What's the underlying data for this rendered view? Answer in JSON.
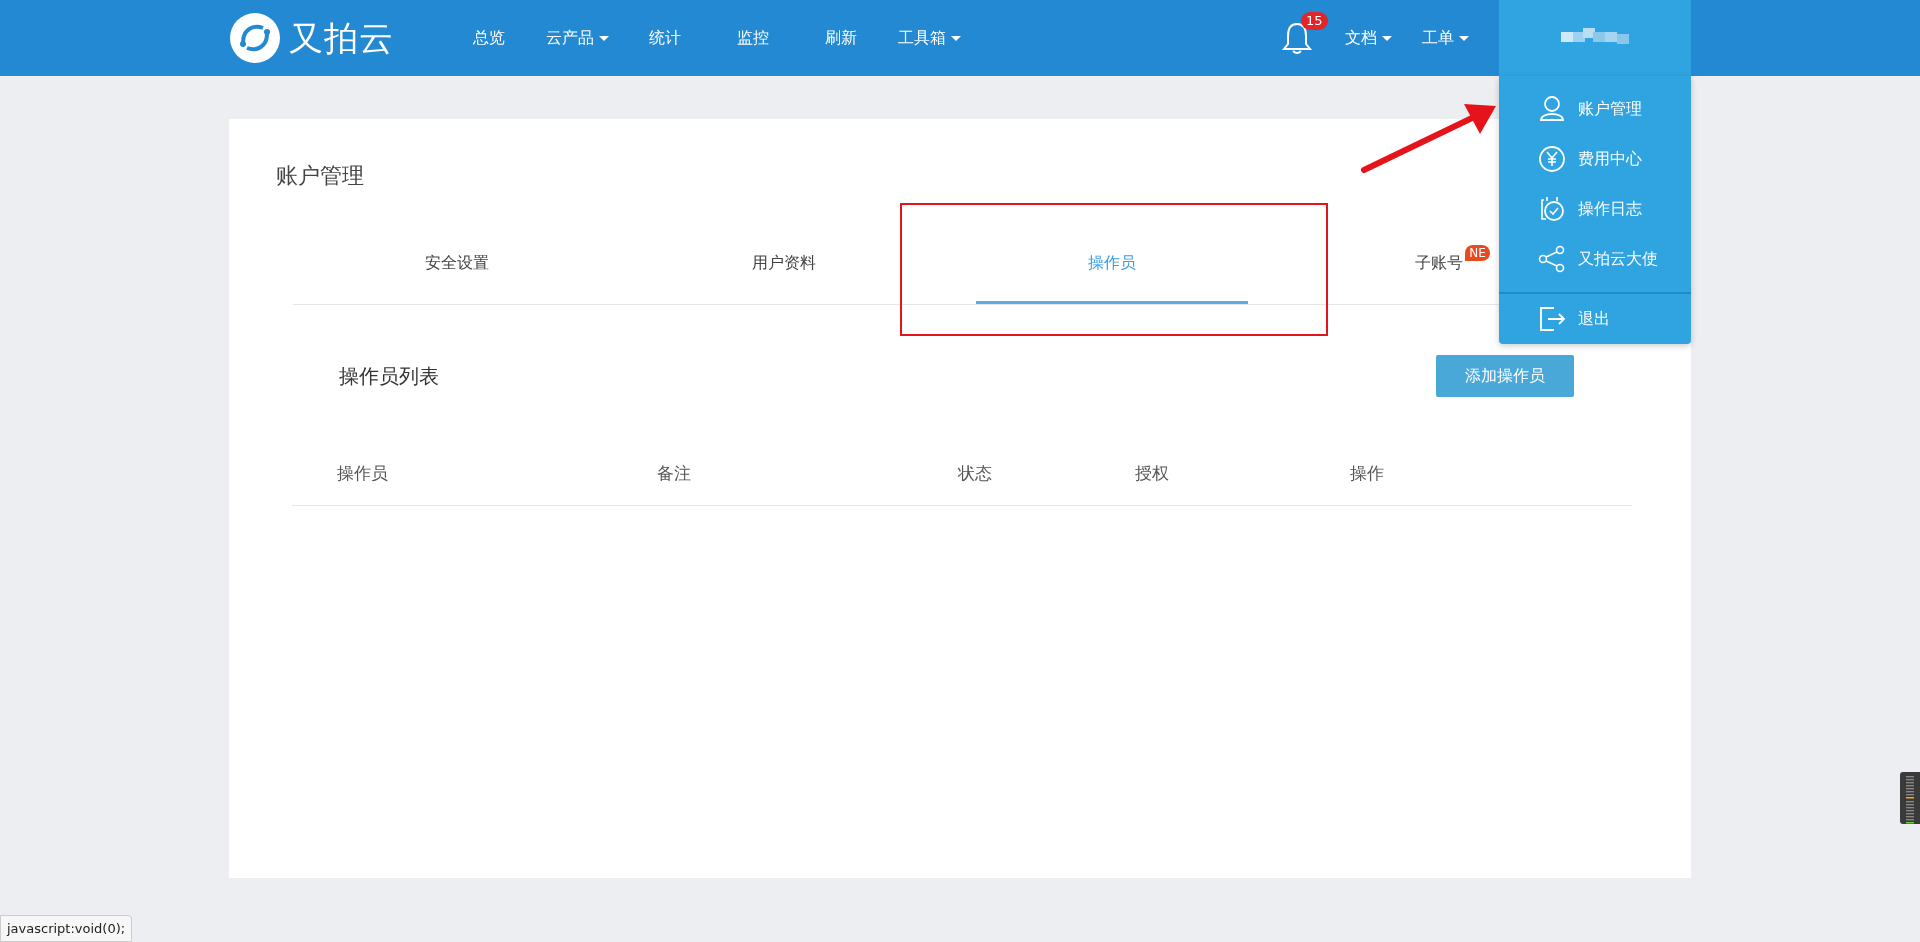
{
  "header": {
    "logo_text": "又拍云",
    "nav": [
      {
        "label": "总览",
        "dropdown": false
      },
      {
        "label": "云产品",
        "dropdown": true
      },
      {
        "label": "统计",
        "dropdown": false
      },
      {
        "label": "监控",
        "dropdown": false
      },
      {
        "label": "刷新",
        "dropdown": false
      },
      {
        "label": "工具箱",
        "dropdown": true
      }
    ],
    "notification_count": "15",
    "right_nav": [
      {
        "label": "文档",
        "dropdown": true
      },
      {
        "label": "工单",
        "dropdown": true
      }
    ]
  },
  "user_menu": {
    "open": true,
    "items": [
      {
        "label": "账户管理"
      },
      {
        "label": "费用中心"
      },
      {
        "label": "操作日志"
      },
      {
        "label": "又拍云大使"
      }
    ],
    "logout": "退出"
  },
  "page": {
    "title": "账户管理",
    "tabs": [
      {
        "label": "安全设置",
        "selected": false
      },
      {
        "label": "用户资料",
        "selected": false
      },
      {
        "label": "操作员",
        "selected": true
      },
      {
        "label": "子账号",
        "selected": false,
        "badge": "NE"
      }
    ],
    "section_title": "操作员列表",
    "add_button": "添加操作员",
    "table": {
      "columns": [
        "操作员",
        "备注",
        "状态",
        "授权",
        "操作"
      ]
    }
  },
  "status_bar": {
    "url": "javascript:void(0);"
  }
}
